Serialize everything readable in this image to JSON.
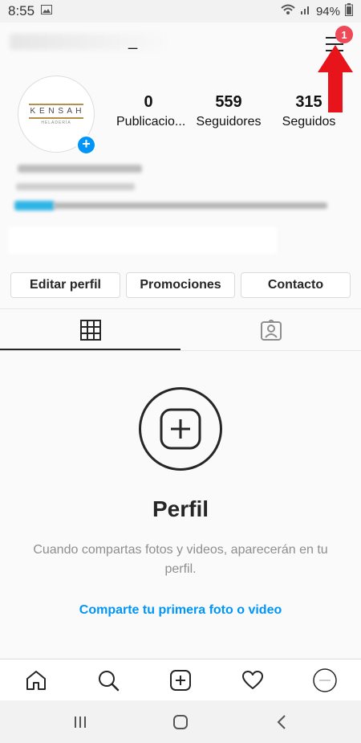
{
  "status_bar": {
    "time": "8:55",
    "battery": "94%"
  },
  "header": {
    "menu_badge": "1",
    "username": "_"
  },
  "profile": {
    "logo_text": "K E N S A H",
    "logo_subtext": "HELADERÍA",
    "stats": [
      {
        "value": "0",
        "label": "Publicacio..."
      },
      {
        "value": "559",
        "label": "Seguidores"
      },
      {
        "value": "315",
        "label": "Seguidos"
      }
    ]
  },
  "actions": {
    "edit": "Editar perfil",
    "promotions": "Promociones",
    "contact": "Contacto"
  },
  "empty_state": {
    "title": "Perfil",
    "description": "Cuando compartas fotos y videos, aparecerán en tu perfil.",
    "link": "Comparte tu primera foto o video"
  },
  "colors": {
    "accent": "#0095f6",
    "badge": "#ed4956",
    "arrow": "#e8141c"
  }
}
